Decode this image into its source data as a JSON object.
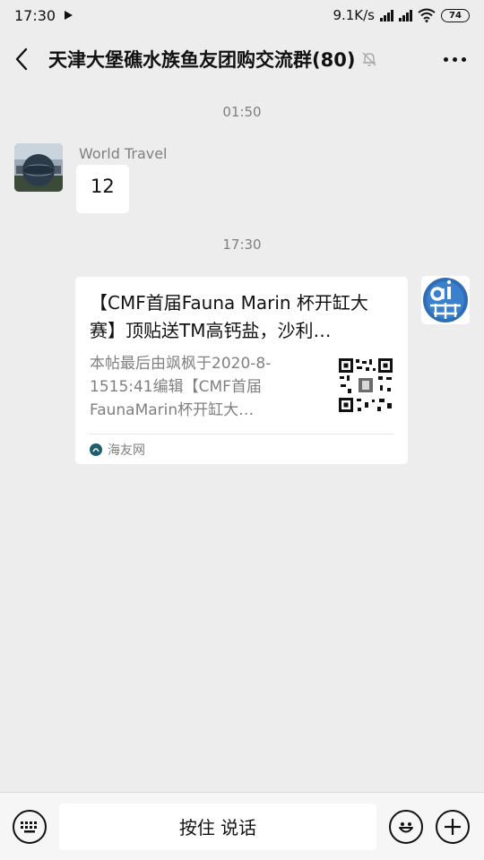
{
  "status": {
    "time": "17:30",
    "net_speed": "9.1K/s",
    "battery": "74"
  },
  "header": {
    "title": "天津大堡礁水族鱼友团购交流群(80)"
  },
  "messages": [
    {
      "time": "01:50",
      "sender": "World Travel",
      "text": "12"
    },
    {
      "time": "17:30",
      "card": {
        "title": "【CMF首届Fauna Marin 杯开缸大赛】顶贴送TM高钙盐，沙利…",
        "desc": "本帖最后由飒枫于2020-8-1515:41编辑【CMF首届FaunaMarin杯开缸大…",
        "source": "海友网"
      }
    }
  ],
  "input_bar": {
    "voice_label": "按住 说话"
  },
  "colors": {
    "background": "#ededed",
    "bubble": "#ffffff",
    "meta_text": "#7f7f7f"
  },
  "icons": [
    "play-icon",
    "signal-icon",
    "wifi-icon",
    "battery-icon",
    "back-icon",
    "mute-bell-icon",
    "more-icon",
    "keyboard-icon",
    "emoji-icon",
    "plus-icon"
  ]
}
